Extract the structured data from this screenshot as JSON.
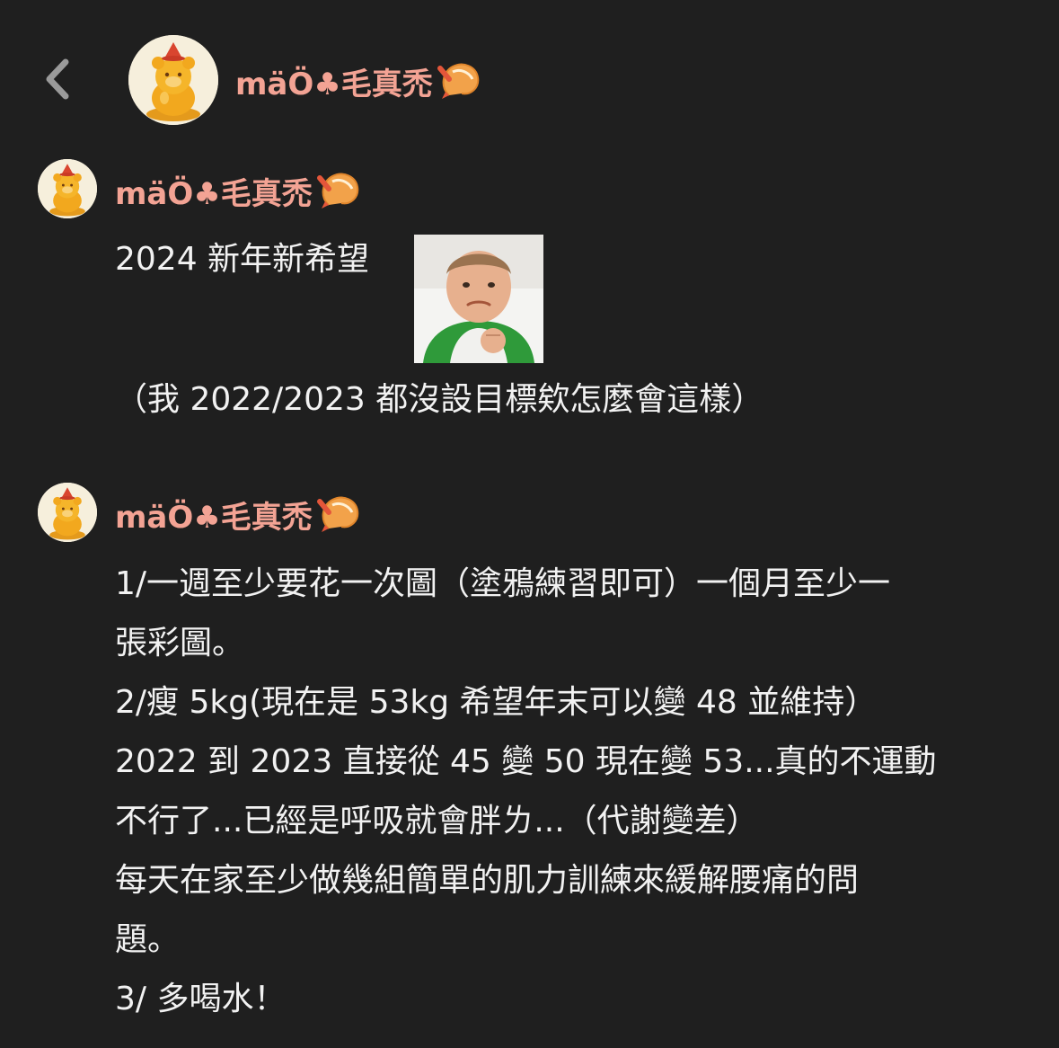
{
  "header": {
    "back_icon": "chevron-left-icon",
    "user_name": "mäÖ♣毛真禿"
  },
  "posts": [
    {
      "user_name": "mäÖ♣毛真禿",
      "lines": [
        "2024 新年新希望",
        "（我 2022/2023 都沒設目標欸怎麼會這樣）"
      ],
      "sticker": "success-kid-sticker"
    },
    {
      "user_name": "mäÖ♣毛真禿",
      "lines": [
        "1/一週至少要花一次圖（塗鴉練習即可）一個月至少一",
        "張彩圖。",
        "2/瘦 5kg(現在是 53kg 希望年末可以變 48 並維持）",
        "2022 到 2023 直接從 45 變 50 現在變 53...真的不運動",
        "不行了...已經是呼吸就會胖ㄌ...（代謝變差）",
        "每天在家至少做幾組簡單的肌力訓練來緩解腰痛的問",
        "題。",
        "3/ 多喝水！"
      ]
    }
  ],
  "colors": {
    "background": "#1f1f1f",
    "name_accent": "#f3a394",
    "text": "#f2f2f2",
    "icon": "#9a9a9a"
  }
}
